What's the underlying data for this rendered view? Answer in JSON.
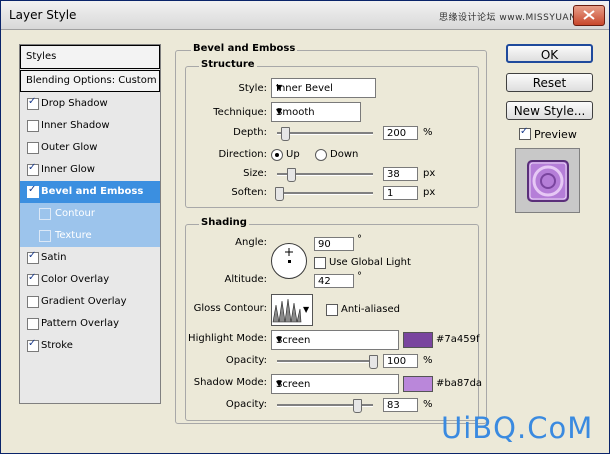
{
  "window": {
    "title": "Layer Style",
    "watermark": "思缘设计论坛  www.MISSYUAN.COM"
  },
  "styles_panel": {
    "header": "Styles",
    "blending_options": "Blending Options: Custom",
    "effects": [
      {
        "label": "Drop Shadow",
        "checked": true,
        "state": "normal"
      },
      {
        "label": "Inner Shadow",
        "checked": false,
        "state": "normal"
      },
      {
        "label": "Outer Glow",
        "checked": false,
        "state": "normal"
      },
      {
        "label": "Inner Glow",
        "checked": true,
        "state": "normal"
      },
      {
        "label": "Bevel and Emboss",
        "checked": true,
        "state": "selected"
      },
      {
        "label": "Contour",
        "checked": false,
        "state": "sub"
      },
      {
        "label": "Texture",
        "checked": false,
        "state": "sub"
      },
      {
        "label": "Satin",
        "checked": true,
        "state": "normal"
      },
      {
        "label": "Color Overlay",
        "checked": true,
        "state": "normal"
      },
      {
        "label": "Gradient Overlay",
        "checked": false,
        "state": "normal"
      },
      {
        "label": "Pattern Overlay",
        "checked": false,
        "state": "normal"
      },
      {
        "label": "Stroke",
        "checked": true,
        "state": "normal"
      }
    ]
  },
  "bevel": {
    "section_title": "Bevel and Emboss",
    "structure": {
      "title": "Structure",
      "style_label": "Style:",
      "style_value": "Inner Bevel",
      "technique_label": "Technique:",
      "technique_value": "Smooth",
      "depth_label": "Depth:",
      "depth_value": "200",
      "depth_unit": "%",
      "depth_level": 0.08,
      "direction_label": "Direction:",
      "direction_up": "Up",
      "direction_down": "Down",
      "direction_selected": "Up",
      "size_label": "Size:",
      "size_value": "38",
      "size_unit": "px",
      "size_level": 0.15,
      "soften_label": "Soften:",
      "soften_value": "1",
      "soften_unit": "px",
      "soften_level": 0.02
    },
    "shading": {
      "title": "Shading",
      "angle_label": "Angle:",
      "angle_value": "90",
      "angle_unit": "°",
      "global_light_label": "Use Global Light",
      "global_light_checked": false,
      "altitude_label": "Altitude:",
      "altitude_value": "42",
      "altitude_unit": "°",
      "gloss_contour_label": "Gloss Contour:",
      "anti_aliased_label": "Anti-aliased",
      "anti_aliased_checked": false,
      "highlight_mode_label": "Highlight Mode:",
      "highlight_mode_value": "Screen",
      "highlight_color": "#7a459f",
      "highlight_color_label": "#7a459f",
      "highlight_opacity_label": "Opacity:",
      "highlight_opacity_value": "100",
      "highlight_opacity_unit": "%",
      "highlight_opacity_level": 1.0,
      "shadow_mode_label": "Shadow Mode:",
      "shadow_mode_value": "Screen",
      "shadow_color": "#ba87da",
      "shadow_color_label": "#ba87da",
      "shadow_opacity_label": "Opacity:",
      "shadow_opacity_value": "83",
      "shadow_opacity_unit": "%",
      "shadow_opacity_level": 0.83
    }
  },
  "buttons": {
    "ok": "OK",
    "reset": "Reset",
    "new_style": "New Style...",
    "preview_label": "Preview",
    "preview_checked": true
  },
  "brand": "UiBQ.CoM"
}
